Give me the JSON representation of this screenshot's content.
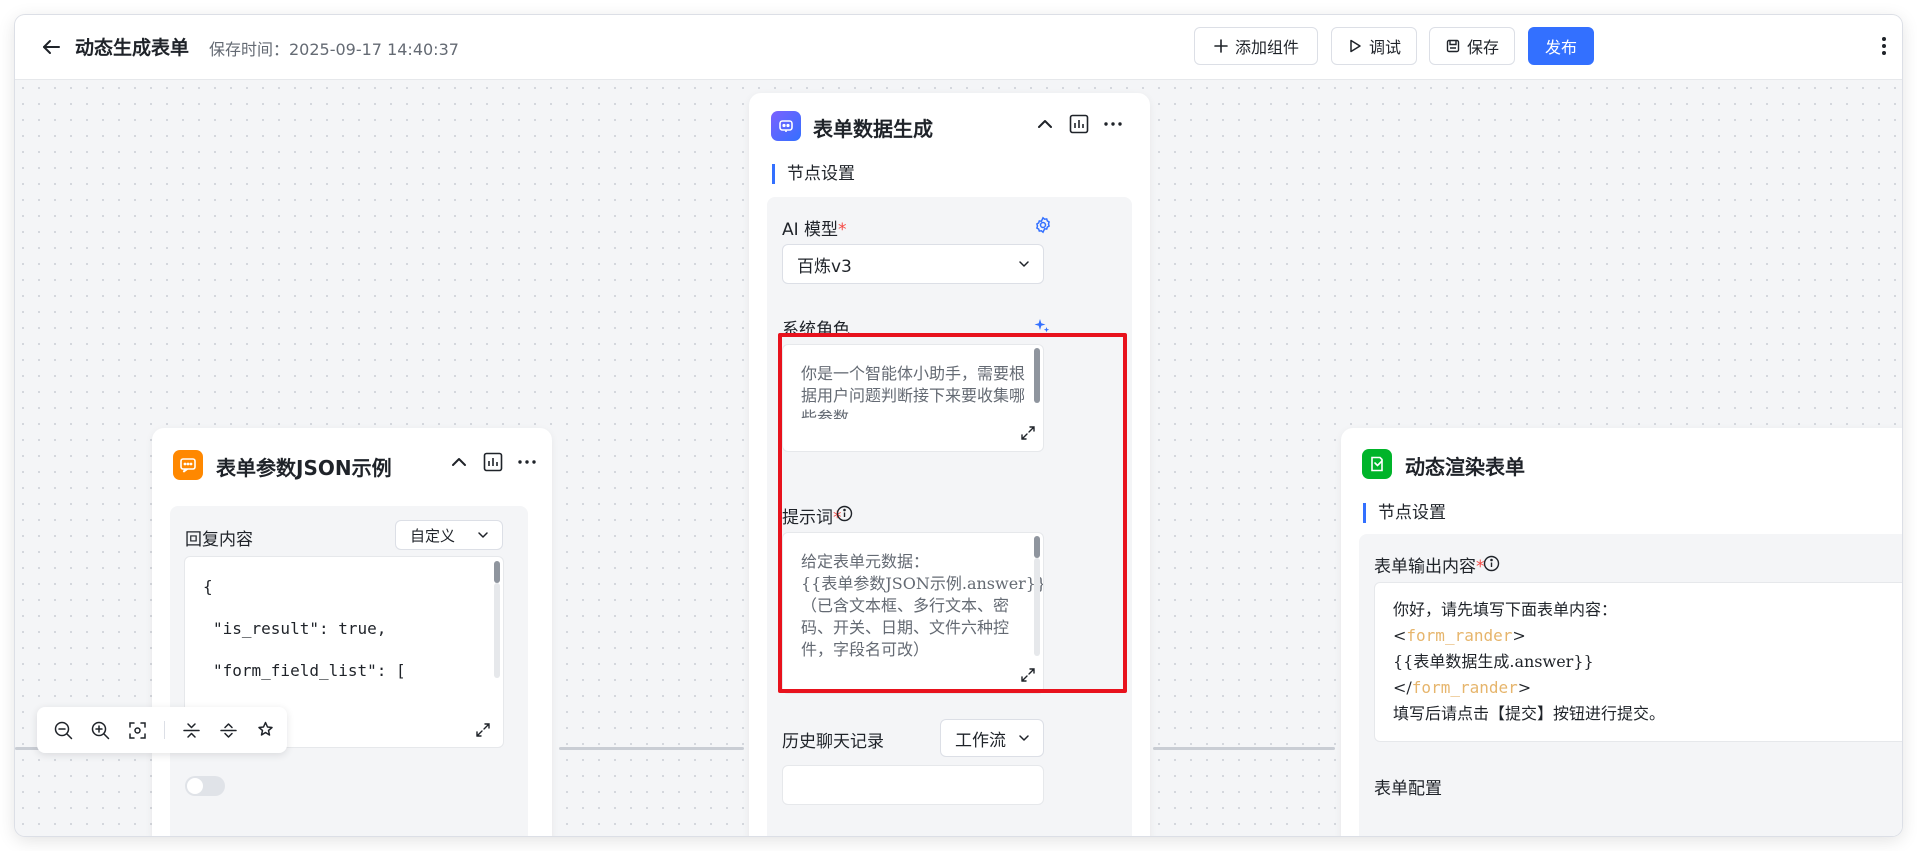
{
  "header": {
    "title": "动态生成表单",
    "save_time": "保存时间：2025-09-17 14:40:37",
    "add_component": "添加组件",
    "debug": "调试",
    "save": "保存",
    "publish": "发布"
  },
  "colors": {
    "accent": "#3370ff",
    "highlight": "#e8121d",
    "required": "#f54a45",
    "tag": "#e6b56c"
  },
  "node_json": {
    "icon": "chat-bubble-icon",
    "title": "表单参数JSON示例",
    "reply_label": "回复内容",
    "reply_mode": "自定义",
    "code_lines": [
      "{",
      "\"is_result\": true,",
      "\"form_field_list\": ["
    ]
  },
  "node_gen": {
    "icon": "bot-icon",
    "title": "表单数据生成",
    "section": "节点设置",
    "model_label": "AI 模型",
    "model_value": "百炼v3",
    "system_role_label": "系统角色",
    "system_role_text": "你是一个智能体小助手，需要根据用户问题判断接下来要收集哪些参数",
    "prompt_label": "提示词",
    "prompt_lines": [
      "给定表单元数据：",
      "{{表单参数JSON示例.answer}}",
      "（已含文本框、多行文本、密码、开关、日期、文件六种控件，字段名可改）"
    ],
    "history_label": "历史聊天记录",
    "history_value": "工作流"
  },
  "node_render": {
    "icon": "form-edit-icon",
    "title": "动态渲染表单",
    "section": "节点设置",
    "output_label": "表单输出内容",
    "line1": "你好，请先填写下面表单内容：",
    "line2_open": "<",
    "line2_tag": "form_rander",
    "line2_close": ">",
    "line3": "{{表单数据生成.answer}}",
    "line4_open": "</",
    "line4_tag": "form_rander",
    "line4_close": ">",
    "line5": "填写后请点击【提交】按钮进行提交。",
    "config_label": "表单配置"
  }
}
